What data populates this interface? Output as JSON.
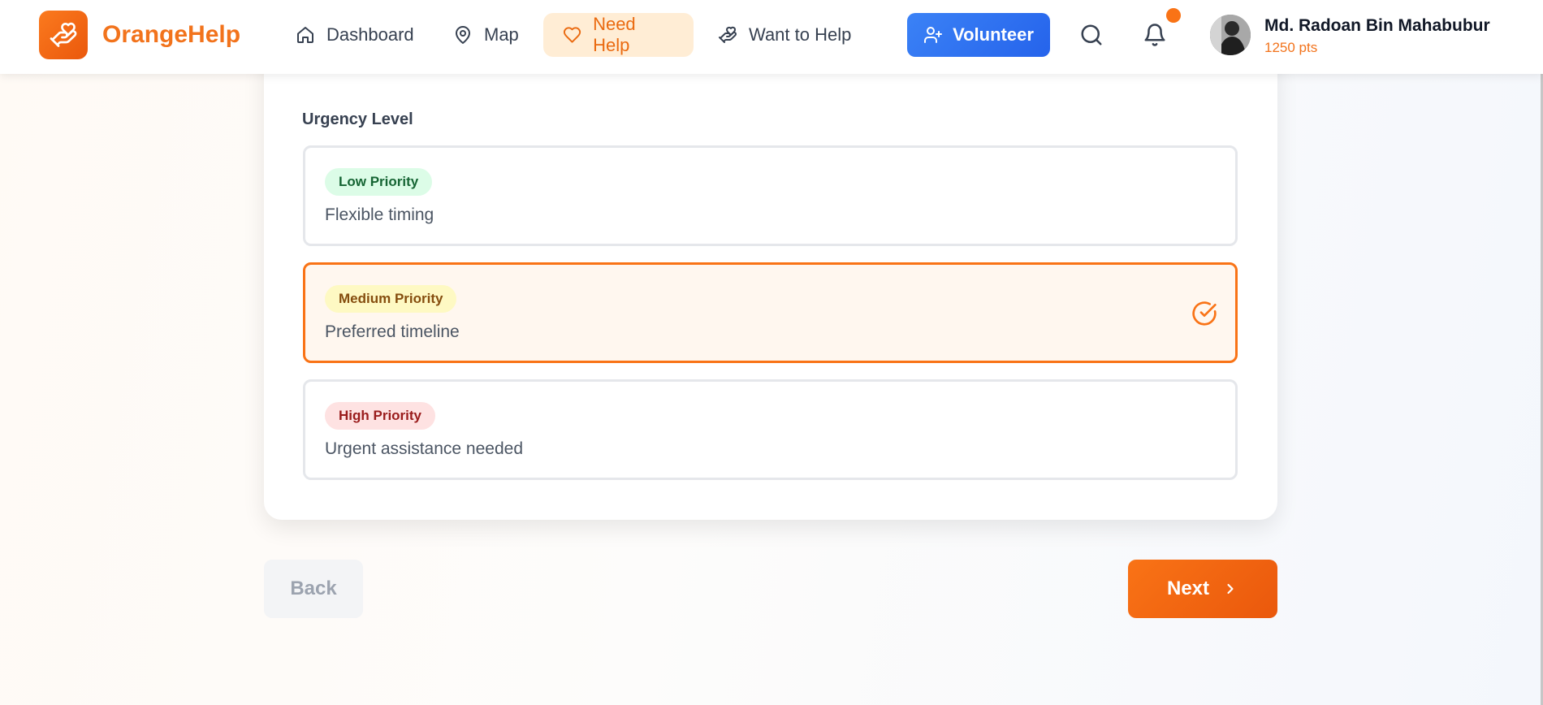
{
  "brand": {
    "name": "OrangeHelp",
    "logo_icon": "hand-heart-icon",
    "accent_color": "#f97316"
  },
  "nav": {
    "items": [
      {
        "label": "Dashboard",
        "icon": "home-icon",
        "active": false
      },
      {
        "label": "Map",
        "icon": "map-pin-icon",
        "active": false
      },
      {
        "label": "Need Help",
        "icon": "heart-icon",
        "active": true
      },
      {
        "label": "Want to Help",
        "icon": "hand-heart-icon",
        "active": false
      }
    ]
  },
  "header": {
    "volunteer_label": "Volunteer",
    "volunteer_icon": "user-plus-icon",
    "volunteer_color": "#3b82f6",
    "search_icon": "search-icon",
    "notifications_icon": "bell-icon",
    "has_unread_notifications": true
  },
  "user": {
    "name": "Md. Radoan Bin Mahabubur",
    "points": "1250 pts"
  },
  "urgency": {
    "label": "Urgency Level",
    "selected": "medium",
    "options": [
      {
        "id": "low",
        "badge": "Low Priority",
        "description": "Flexible timing",
        "selected": false
      },
      {
        "id": "medium",
        "badge": "Medium Priority",
        "description": "Preferred timeline",
        "selected": true
      },
      {
        "id": "high",
        "badge": "High Priority",
        "description": "Urgent assistance needed",
        "selected": false
      }
    ]
  },
  "footer": {
    "back_label": "Back",
    "next_label": "Next"
  }
}
